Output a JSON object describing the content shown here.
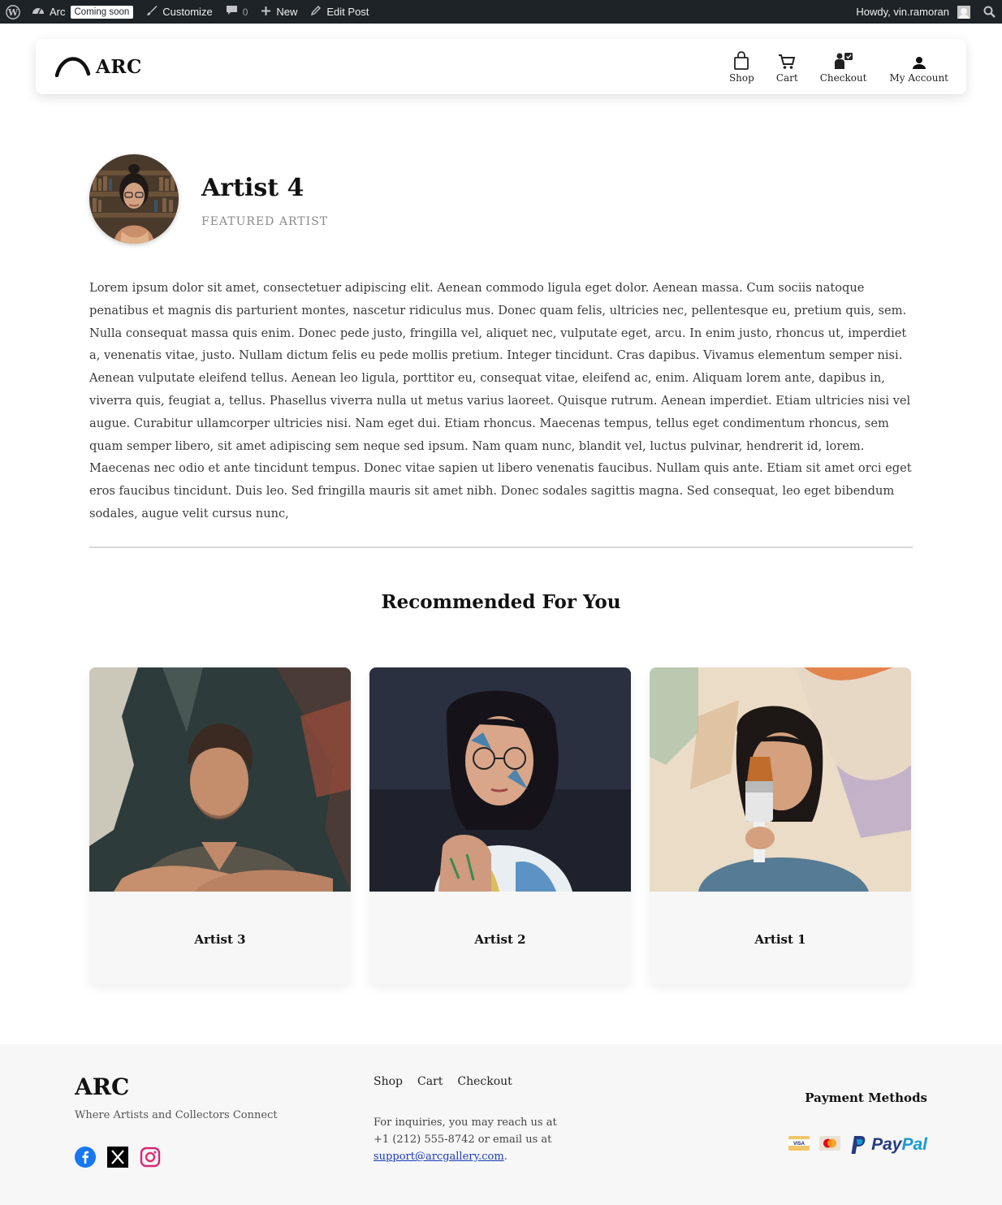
{
  "adminbar": {
    "site_name": "Arc",
    "badge": "Coming soon",
    "customize": "Customize",
    "comments_count": "0",
    "new_label": "New",
    "edit_post": "Edit Post",
    "howdy": "Howdy, vin.ramoran"
  },
  "header": {
    "brand": "ARC",
    "nav": [
      {
        "label": "Shop",
        "icon": "shopping-bag-icon"
      },
      {
        "label": "Cart",
        "icon": "cart-icon"
      },
      {
        "label": "Checkout",
        "icon": "checkout-icon"
      },
      {
        "label": "My Account",
        "icon": "account-icon"
      }
    ]
  },
  "artist": {
    "name": "Artist 4",
    "subtitle": "FEATURED ARTIST",
    "bio": "Lorem ipsum dolor sit amet, consectetuer adipiscing elit. Aenean commodo ligula eget dolor. Aenean massa. Cum sociis natoque penatibus et magnis dis parturient montes, nascetur ridiculus mus. Donec quam felis, ultricies nec, pellentesque eu, pretium quis, sem. Nulla consequat massa quis enim. Donec pede justo, fringilla vel, aliquet nec, vulputate eget, arcu. In enim justo, rhoncus ut, imperdiet a, venenatis vitae, justo. Nullam dictum felis eu pede mollis pretium. Integer tincidunt. Cras dapibus. Vivamus elementum semper nisi. Aenean vulputate eleifend tellus. Aenean leo ligula, porttitor eu, consequat vitae, eleifend ac, enim. Aliquam lorem ante, dapibus in, viverra quis, feugiat a, tellus. Phasellus viverra nulla ut metus varius laoreet. Quisque rutrum. Aenean imperdiet. Etiam ultricies nisi vel augue. Curabitur ullamcorper ultricies nisi. Nam eget dui. Etiam rhoncus. Maecenas tempus, tellus eget condimentum rhoncus, sem quam semper libero, sit amet adipiscing sem neque sed ipsum. Nam quam nunc, blandit vel, luctus pulvinar, hendrerit id, lorem. Maecenas nec odio et ante tincidunt tempus. Donec vitae sapien ut libero venenatis faucibus. Nullam quis ante. Etiam sit amet orci eget eros faucibus tincidunt. Duis leo. Sed fringilla mauris sit amet nibh. Donec sodales sagittis magna. Sed consequat, leo eget bibendum sodales, augue velit cursus nunc,"
  },
  "recommended": {
    "title": "Recommended For You",
    "cards": [
      {
        "name": "Artist 3"
      },
      {
        "name": "Artist 2"
      },
      {
        "name": "Artist 1"
      }
    ]
  },
  "footer": {
    "logo": "ARC",
    "tagline": "Where Artists and Collectors Connect",
    "links": [
      "Shop",
      "Cart",
      "Checkout"
    ],
    "contact_line1": "For inquiries, you may reach us at",
    "contact_line2": "+1 (212) 555-8742 or email us at",
    "email": "support@arcgallery.com",
    "period": ".",
    "payment_title": "Payment Methods",
    "visa": "VISA",
    "paypal_pay": "Pay",
    "paypal_pal": "Pal"
  },
  "colors": {
    "adminbar": "#1d2327",
    "footer_bg": "#f7f7f7",
    "link": "#1a3bb8",
    "paypal_dark": "#253b80",
    "paypal_light": "#179bd7"
  }
}
